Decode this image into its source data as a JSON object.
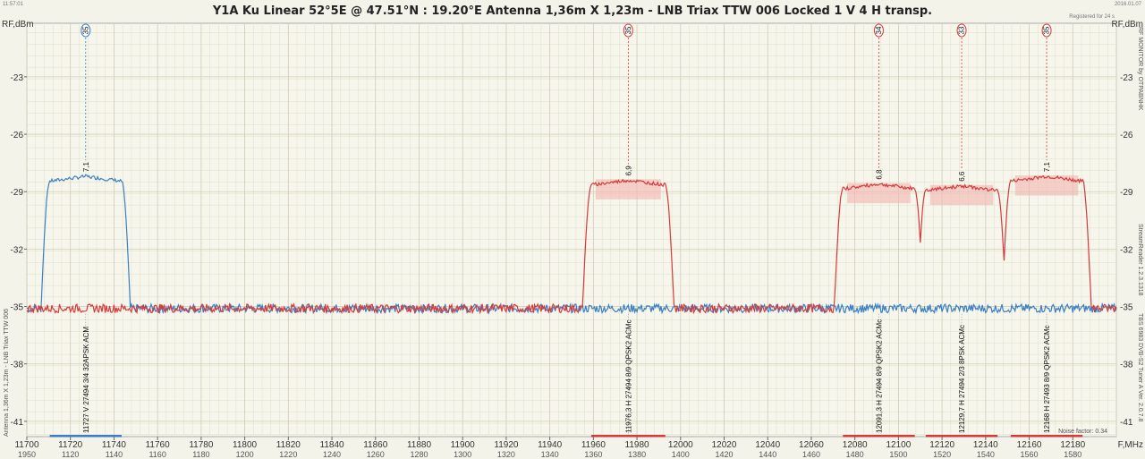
{
  "header": {
    "title": "Y1A Ku Linear    52°5E  @  47.51°N : 19.20°E     Antenna 1,36m X 1,23m - LNB Triax TTW 006       Locked  1 V  4 H transp.",
    "time": "11:57:01",
    "date": "2016.01.07",
    "registered": "Registered for 24 s"
  },
  "side_labels": {
    "left": "Antenna 1,36m X 1,23m - LNB Triax TTW 006",
    "right_top": "RF MONITOR  by  OTPABNHK",
    "right_mid": "StreamReader 1.2.3.1318",
    "right_bottom": "TBS 6983 DVB-S2 Tuner A    Ver. 2.0.7.8",
    "noise": "Noise factor: 0.34"
  },
  "chart_data": {
    "type": "line",
    "title": "Y1A Ku Linear    52°5E  @  47.51°N : 19.20°E     Antenna 1,36m X 1,23m - LNB Triax TTW 006       Locked  1 V  4 H transp.",
    "xlabel": "F,MHz",
    "ylabel_left": "RF,dBm",
    "ylabel_right": "RF,dBm",
    "xlim": [
      11700,
      12200
    ],
    "ylim": [
      -41.8,
      -20.2
    ],
    "x_ticks": [
      11700,
      11720,
      11740,
      11760,
      11780,
      11800,
      11820,
      11840,
      11860,
      11880,
      11900,
      11920,
      11940,
      11960,
      11980,
      12000,
      12020,
      12040,
      12060,
      12080,
      12100,
      12120,
      12140,
      12160,
      12180
    ],
    "if_ticks": [
      1950,
      1120,
      1140,
      1160,
      1180,
      1200,
      1220,
      1240,
      1260,
      1280,
      1300,
      1320,
      1340,
      1360,
      1380,
      1400,
      1420,
      1440,
      1460,
      1480,
      1500,
      1520,
      1540,
      1560,
      1580
    ],
    "y_ticks": [
      -23,
      -26,
      -29,
      -32,
      -35,
      -38,
      -41
    ],
    "noise_floor": -35.1,
    "grid": true,
    "colors": {
      "vertical": "#3a7fc4",
      "horizontal": "#d63a3a",
      "grid": "#d9d9c4",
      "background": "#f3f3ea"
    },
    "transponders": [
      {
        "pol": "V",
        "center": 11727,
        "width": 33,
        "level": -28.2,
        "snr": "7,1",
        "marker": "35",
        "info": "11727 V 27494 3/4 32APSK ACM"
      },
      {
        "pol": "H",
        "center": 11976,
        "width": 34,
        "level": -28.4,
        "snr": "6,9",
        "marker": "35",
        "info": "11976,3 H 27494 8/9 QPSK2 ACMc"
      },
      {
        "pol": "H",
        "center": 12091,
        "width": 33,
        "level": -28.6,
        "snr": "6,8",
        "marker": "34",
        "info": "12091,3 H 27494 8/9 QPSK2 ACMc"
      },
      {
        "pol": "H",
        "center": 12129,
        "width": 33,
        "level": -28.7,
        "snr": "6,6",
        "marker": "33",
        "info": "12129,7 H 27494 2/3 8PSK ACMc"
      },
      {
        "pol": "H",
        "center": 12168,
        "width": 33,
        "level": -28.2,
        "snr": "7,1",
        "marker": "35",
        "info": "12168 H 27493 8/9 QPSK2 ACMc"
      }
    ]
  }
}
